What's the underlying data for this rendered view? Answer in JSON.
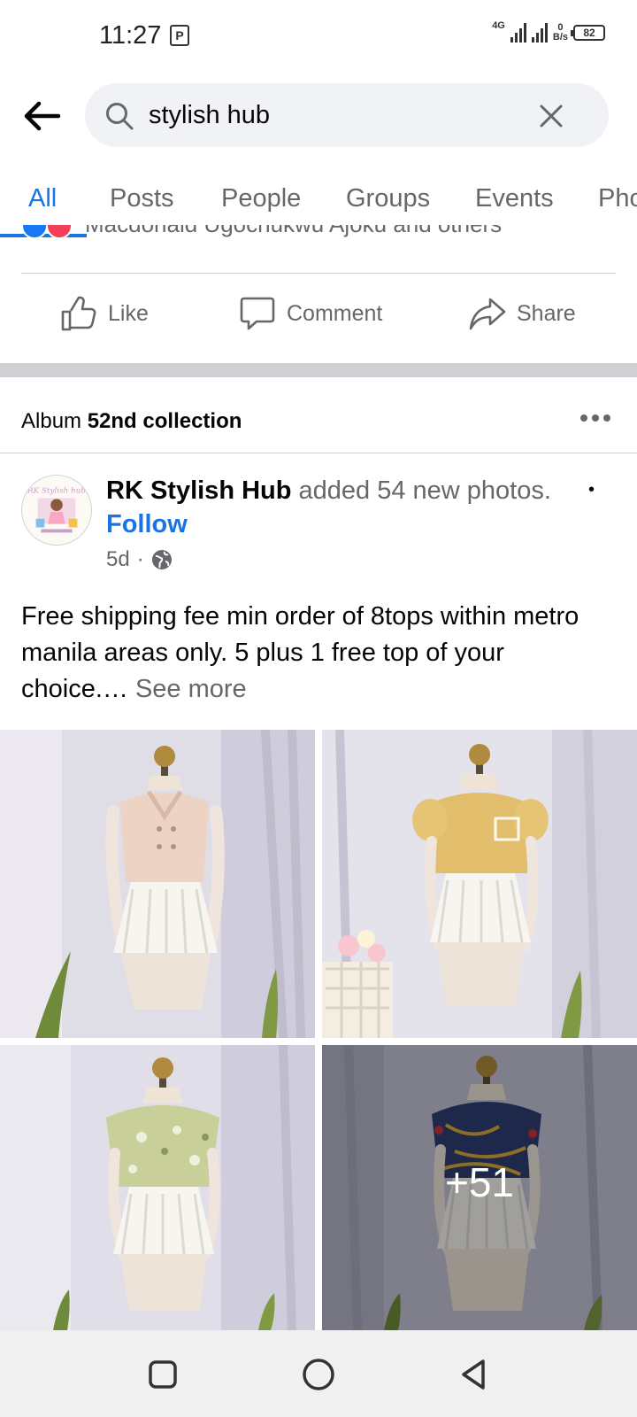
{
  "status_bar": {
    "time": "11:27",
    "network": "4G",
    "speed_value": "0",
    "speed_unit": "B/s",
    "battery": "82"
  },
  "search": {
    "query": "stylish hub"
  },
  "tabs": [
    {
      "label": "All",
      "active": true
    },
    {
      "label": "Posts",
      "active": false
    },
    {
      "label": "People",
      "active": false
    },
    {
      "label": "Groups",
      "active": false
    },
    {
      "label": "Events",
      "active": false
    },
    {
      "label": "Pho",
      "active": false
    }
  ],
  "previous_post": {
    "reactions_text": "Macdonald Ugochukwu Ajoku and others",
    "actions": {
      "like": "Like",
      "comment": "Comment",
      "share": "Share"
    }
  },
  "album": {
    "prefix": "Album",
    "name": "52nd collection"
  },
  "post": {
    "page_name": "RK Stylish Hub",
    "action_text": "added 54 new photos.",
    "separator": "•",
    "follow_label": "Follow",
    "age": "5d",
    "age_separator": "·",
    "audience_icon": "globe-icon",
    "text": "Free shipping fee min order of 8tops within metro manila areas only. 5 plus 1 free top of your choice.…",
    "see_more": "See more",
    "more_photos": "+51"
  },
  "colors": {
    "accent": "#1b74e4",
    "secondary_text": "#65676b",
    "search_bg": "#f0f2f5"
  }
}
